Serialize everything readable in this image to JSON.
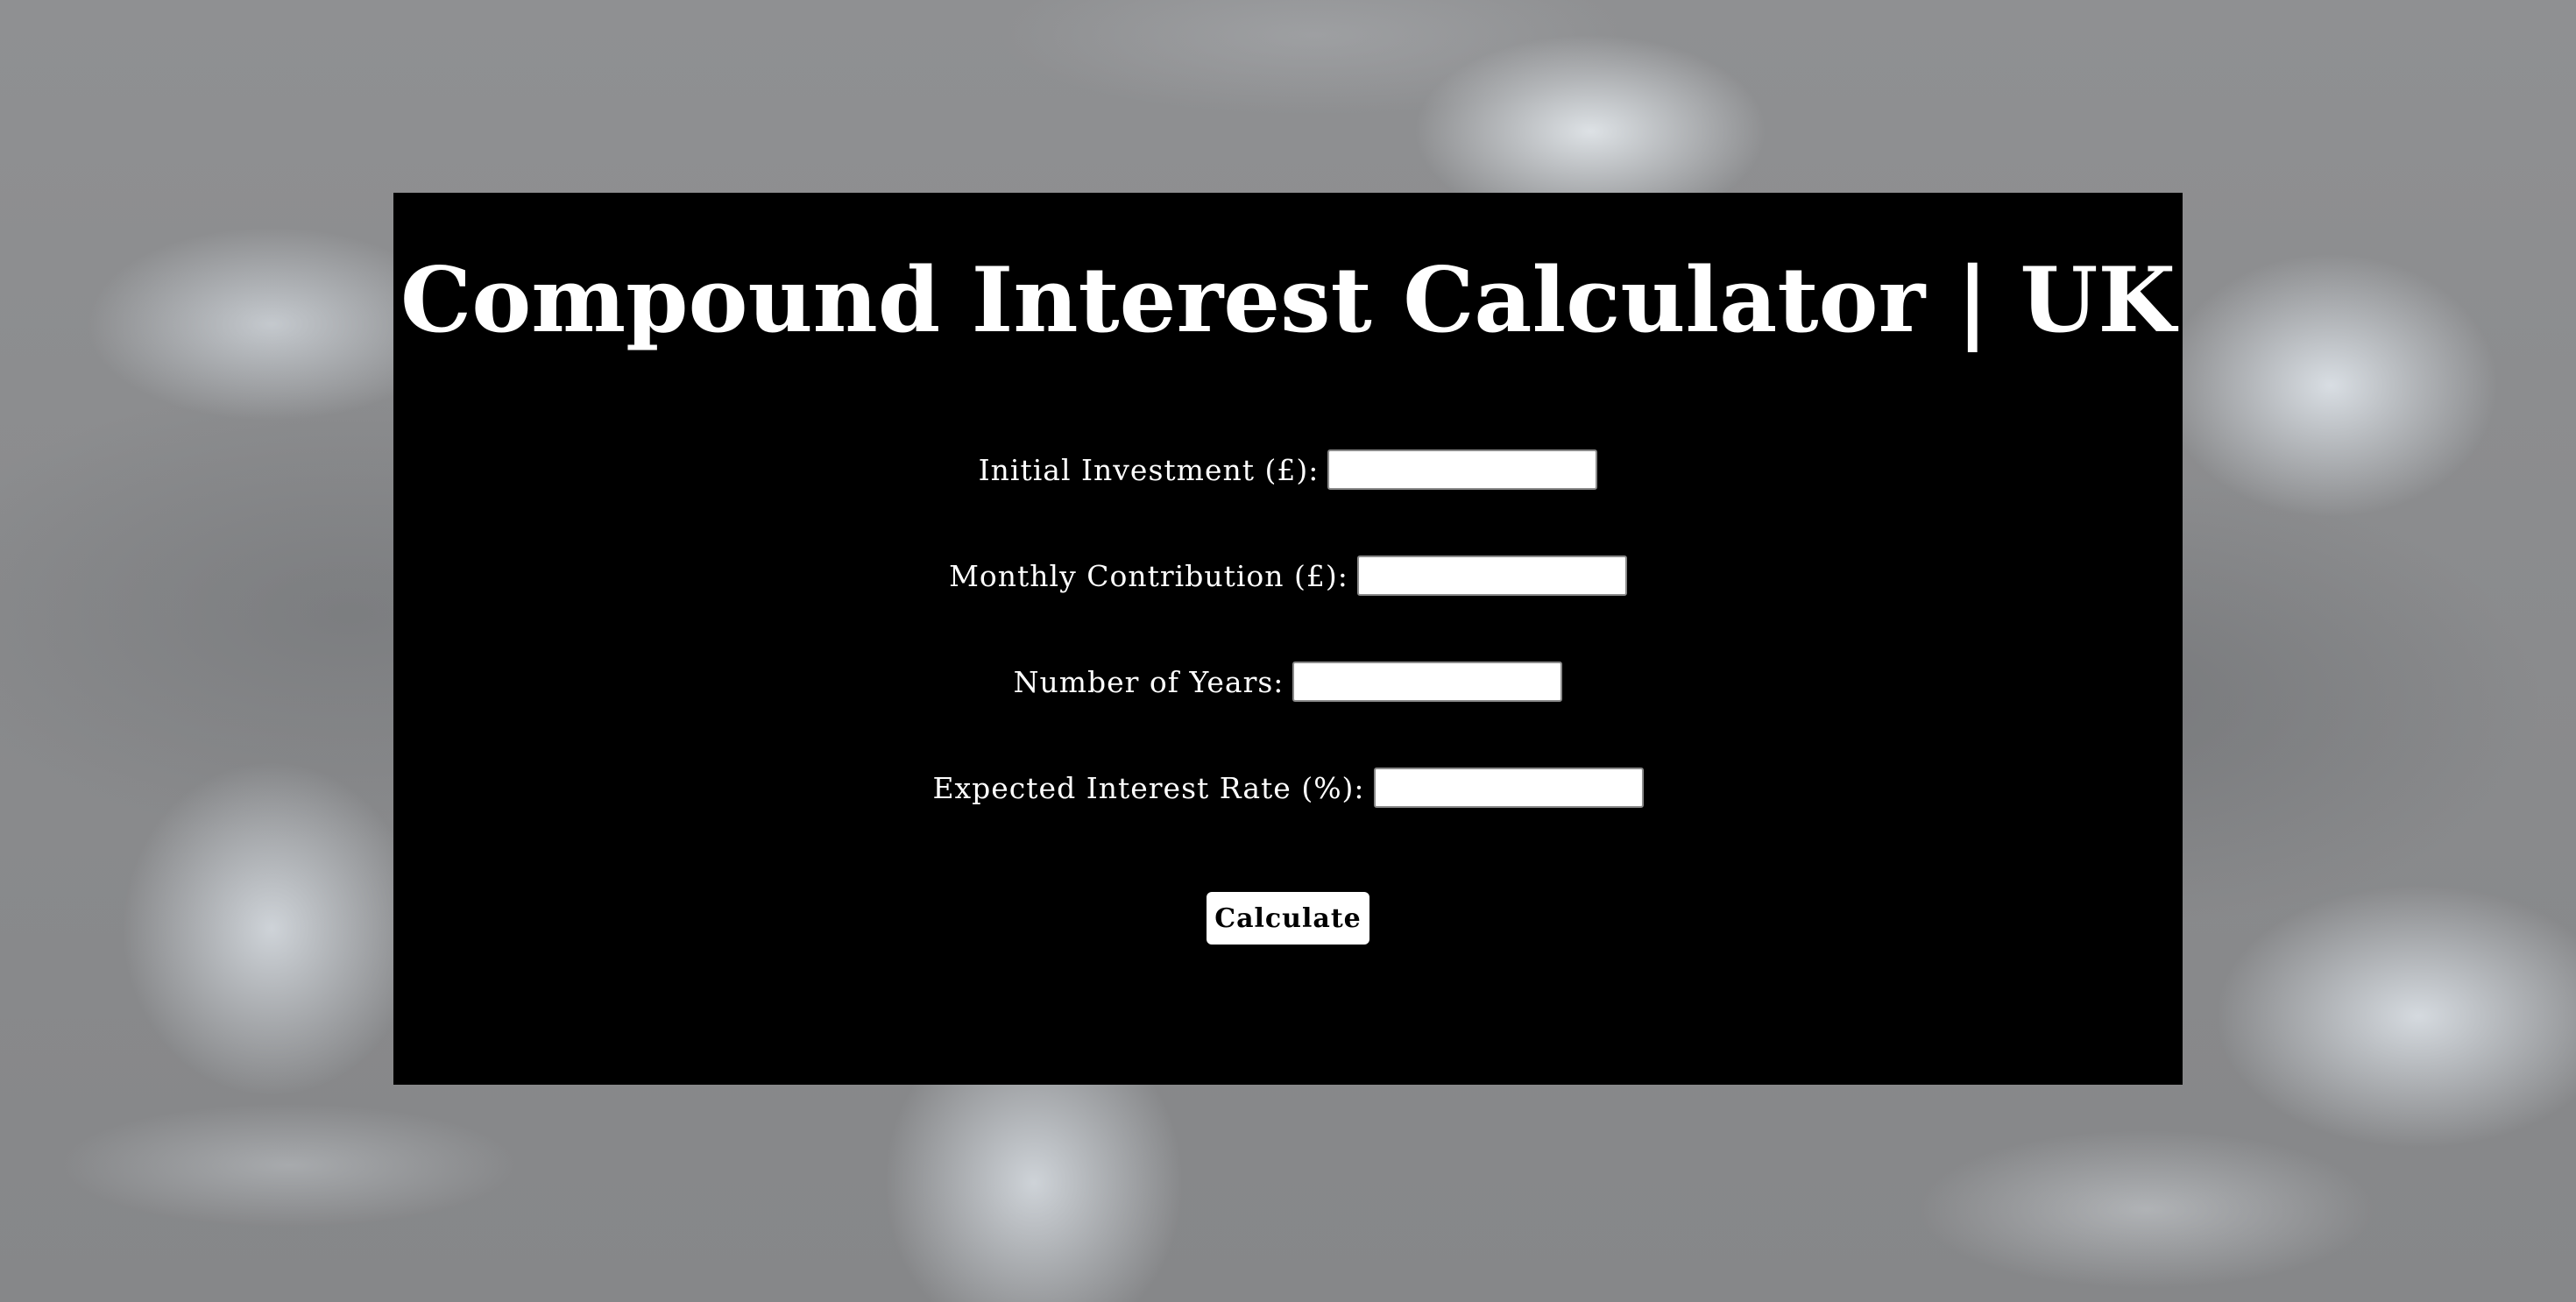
{
  "page": {
    "title": "Compound Interest Calculator | UK"
  },
  "form": {
    "fields": [
      {
        "label": "Initial Investment (£):",
        "value": "",
        "placeholder": ""
      },
      {
        "label": "Monthly Contribution (£):",
        "value": "",
        "placeholder": ""
      },
      {
        "label": "Number of Years:",
        "value": "",
        "placeholder": ""
      },
      {
        "label": "Expected Interest Rate (%):",
        "value": "",
        "placeholder": ""
      }
    ],
    "calculate_label": "Calculate"
  },
  "colors": {
    "panel_background": "#000000",
    "text": "#ffffff",
    "input_background": "#ffffff",
    "button_background": "#ffffff",
    "button_text": "#000000"
  }
}
